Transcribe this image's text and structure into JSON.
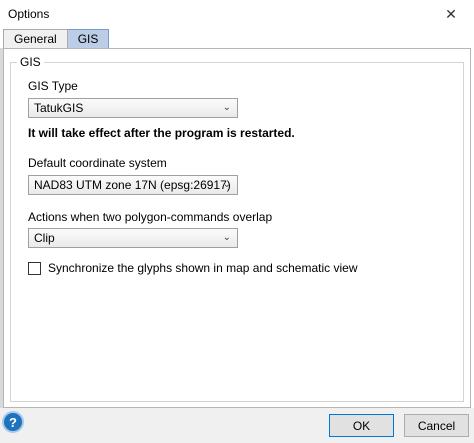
{
  "window": {
    "title": "Options",
    "close_glyph": "✕"
  },
  "tabs": [
    {
      "label": "General",
      "active": false
    },
    {
      "label": "GIS",
      "active": true
    }
  ],
  "gis_group": {
    "legend": "GIS",
    "gis_type_label": "GIS Type",
    "gis_type_value": "TatukGIS",
    "restart_notice": "It will take effect after the program is restarted.",
    "coordinate_label": "Default coordinate system",
    "coordinate_value": "NAD83 UTM zone 17N (epsg:26917)",
    "overlap_label": "Actions when two polygon-commands overlap",
    "overlap_value": "Clip",
    "sync_label": "Synchronize the glyphs shown in map and schematic view",
    "sync_checked": false
  },
  "footer": {
    "help_glyph": "?",
    "ok_label": "OK",
    "cancel_label": "Cancel"
  },
  "icons": {
    "dropdown": "chevron-down-icon",
    "close": "close-icon",
    "help": "help-icon"
  },
  "colors": {
    "active_tab": "#bccde8",
    "help_blue": "#1e73be",
    "ok_border": "#0078d7"
  }
}
